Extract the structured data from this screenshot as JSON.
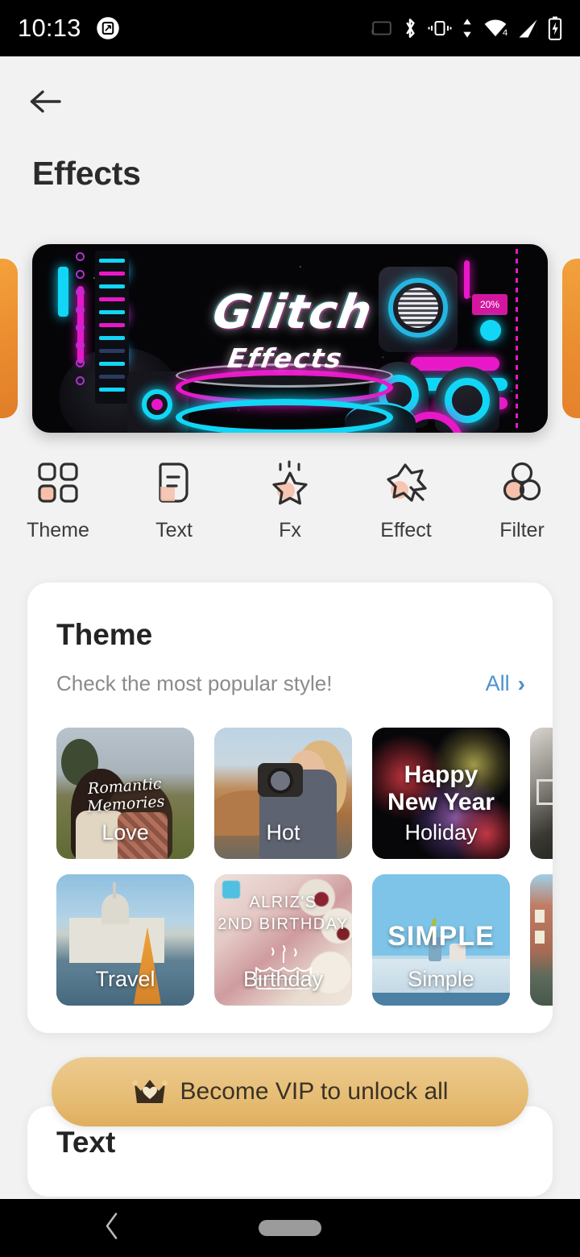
{
  "status_bar": {
    "time": "10:13",
    "left_icons": [
      "screenshot-icon"
    ],
    "right_icons": [
      "cast-icon",
      "bluetooth-icon",
      "vibrate-icon",
      "data-transfer-icon",
      "wifi-icon",
      "signal-icon",
      "battery-charging-icon"
    ],
    "wifi_label": "4"
  },
  "appbar": {
    "back_icon": "arrow-left-icon",
    "title": "Effects"
  },
  "banner": {
    "title": "Glitch",
    "subtitle": "Effects",
    "badge": "20%",
    "side_left_color": "#ea8c2f",
    "side_right_color": "#ea8c2f",
    "neon_pink": "#e818c8",
    "neon_cyan": "#12d6f5"
  },
  "categories": [
    {
      "label": "Theme",
      "icon": "grid-four-squares-icon"
    },
    {
      "label": "Text",
      "icon": "text-document-icon"
    },
    {
      "label": "Fx",
      "icon": "sparkle-star-icon"
    },
    {
      "label": "Effect",
      "icon": "star-arrow-icon"
    },
    {
      "label": "Filter",
      "icon": "three-circles-icon"
    }
  ],
  "theme_section": {
    "title": "Theme",
    "subtitle": "Check the most popular style!",
    "all_label": "All",
    "all_chevron": "chevron-right-icon",
    "all_color": "#4b92cf",
    "rows": [
      [
        {
          "label": "Love",
          "overlay": "Romantic Memories"
        },
        {
          "label": "Hot",
          "overlay": ""
        },
        {
          "label": "Holiday",
          "overlay": "Happy New Year"
        },
        {
          "label": "",
          "overlay": ""
        }
      ],
      [
        {
          "label": "Travel",
          "overlay": ""
        },
        {
          "label": "Birthday",
          "overlay": "ALRIZ'S\n2ND BIRTHDAY"
        },
        {
          "label": "Simple",
          "overlay": "SIMPLE"
        },
        {
          "label": "",
          "overlay": ""
        }
      ]
    ]
  },
  "vip": {
    "label": "Become VIP to unlock all",
    "icon": "crown-icon",
    "bg_color": "#e6bd75"
  },
  "text_section": {
    "title": "Text"
  },
  "navbar": {
    "back_icon": "nav-back-chevron-icon",
    "home_pill": "home-pill-icon"
  }
}
